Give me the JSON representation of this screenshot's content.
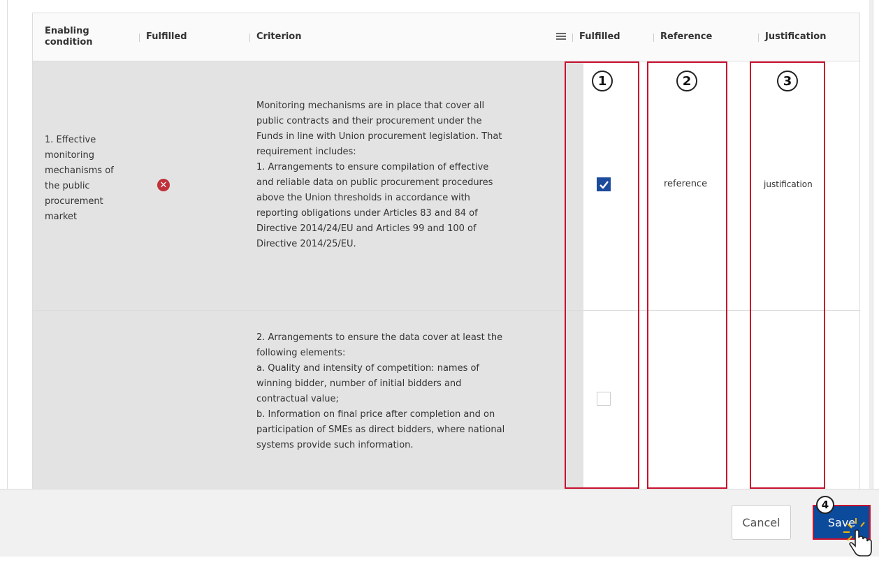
{
  "table": {
    "headers": {
      "enabling_condition": "Enabling\ncondition",
      "fulfilled_1": "Fulfilled",
      "criterion": "Criterion",
      "fulfilled_2": "Fulfilled",
      "reference": "Reference",
      "justification": "Justification"
    },
    "rows": [
      {
        "enabling_condition": "1. Effective\nmonitoring\nmechanisms of\nthe public\nprocurement\nmarket",
        "fulfilled_status": "not-fulfilled-icon",
        "criterion": "Monitoring mechanisms are in place that cover all\npublic contracts and their procurement under the\nFunds in line with Union procurement legislation. That\nrequirement includes:\n1. Arrangements to ensure compilation of effective\nand reliable data on public procurement procedures\nabove the Union thresholds in accordance with\nreporting obligations under Articles 83 and 84 of\nDirective 2014/24/EU and Articles 99 and 100 of\nDirective 2014/25/EU.",
        "checked": true,
        "reference": "reference",
        "justification": "justification"
      },
      {
        "enabling_condition": "",
        "criterion": "2. Arrangements to ensure the data cover at least the\nfollowing elements:\na. Quality and intensity of competition: names of\nwinning bidder, number of initial bidders and\ncontractual value;\nb. Information on final price after completion and on\nparticipation of SMEs as direct bidders, where national\nsystems provide such information.",
        "checked": false,
        "reference": "",
        "justification": ""
      }
    ]
  },
  "annotations": {
    "badge_1": "1",
    "badge_2": "2",
    "badge_3": "3",
    "badge_4": "4"
  },
  "footer": {
    "cancel_label": "Cancel",
    "save_label": "Save"
  },
  "colors": {
    "accent": "#0c4a9c",
    "highlight": "#c8102e",
    "error": "#c0323b"
  }
}
